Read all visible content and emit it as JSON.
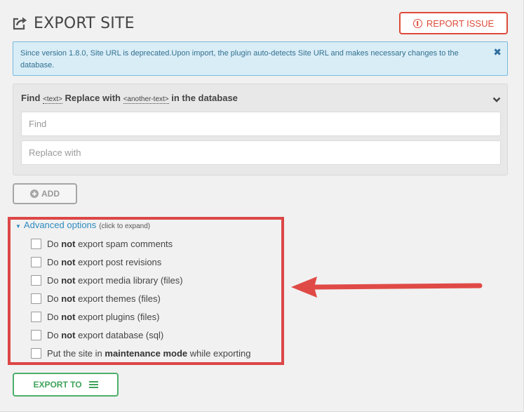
{
  "header": {
    "title": "EXPORT SITE",
    "report_label": "REPORT ISSUE"
  },
  "notice": {
    "text": "Since version 1.8.0, Site URL is deprecated.Upon import, the plugin auto-detects Site URL and makes necessary changes to the database.",
    "close_glyph": "✖"
  },
  "find_replace": {
    "heading_find": "Find",
    "tag_text": "<text>",
    "heading_replace": "Replace with",
    "tag_another": "<another-text>",
    "heading_suffix": "in the database",
    "find_placeholder": "Find",
    "replace_placeholder": "Replace with",
    "find_value": "",
    "replace_value": ""
  },
  "add_button": {
    "label": "ADD"
  },
  "advanced": {
    "label": "Advanced options",
    "hint": "(click to expand)",
    "options": [
      {
        "prefix": "Do ",
        "bold": "not",
        "suffix": " export spam comments"
      },
      {
        "prefix": "Do ",
        "bold": "not",
        "suffix": " export post revisions"
      },
      {
        "prefix": "Do ",
        "bold": "not",
        "suffix": " export media library (files)"
      },
      {
        "prefix": "Do ",
        "bold": "not",
        "suffix": " export themes (files)"
      },
      {
        "prefix": "Do ",
        "bold": "not",
        "suffix": " export plugins (files)"
      },
      {
        "prefix": "Do ",
        "bold": "not",
        "suffix": " export database (sql)"
      },
      {
        "prefix": "Put the site in ",
        "bold": "maintenance mode",
        "suffix": " while exporting"
      }
    ]
  },
  "export_button": {
    "label": "EXPORT TO"
  },
  "colors": {
    "danger": "#dd4b39",
    "info_bg": "#d9edf7",
    "link": "#2e8bc0",
    "success": "#4caf6a",
    "highlight": "#dd4646"
  },
  "icons": {
    "title": "export-icon",
    "report": "alert-circle-icon",
    "close": "close-icon",
    "panel": "chevron-down-icon",
    "add": "plus-circle-icon",
    "export": "menu-icon",
    "annotation": "arrow-left-icon"
  }
}
